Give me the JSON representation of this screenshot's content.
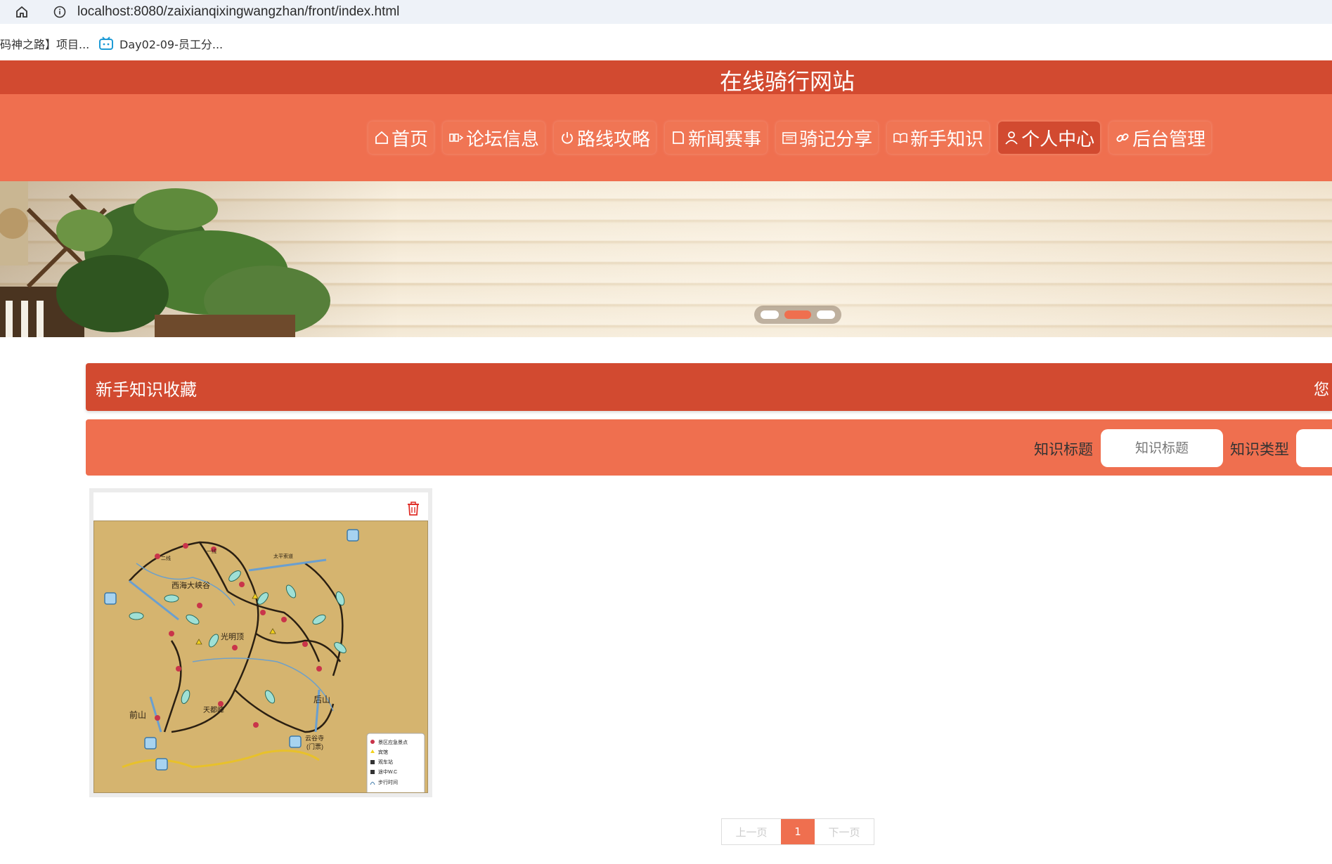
{
  "browser": {
    "url": "localhost:8080/zaixianqixingwangzhan/front/index.html",
    "bookmarks": [
      "码神之路】项目...",
      "Day02-09-员工分..."
    ]
  },
  "site": {
    "title": "在线骑行网站",
    "nav": [
      {
        "label": "首页",
        "icon": "home-icon"
      },
      {
        "label": "论坛信息",
        "icon": "forum-icon"
      },
      {
        "label": "路线攻略",
        "icon": "power-icon"
      },
      {
        "label": "新闻赛事",
        "icon": "news-icon"
      },
      {
        "label": "骑记分享",
        "icon": "calendar-icon"
      },
      {
        "label": "新手知识",
        "icon": "book-icon"
      },
      {
        "label": "个人中心",
        "icon": "user-icon",
        "active": true
      },
      {
        "label": "后台管理",
        "icon": "link-icon"
      }
    ]
  },
  "banner": {
    "slides": 3,
    "active_slide": 2
  },
  "section": {
    "title": "新手知识收藏",
    "right_text": "您"
  },
  "search": {
    "title_label": "知识标题",
    "title_placeholder": "知识标题",
    "type_label": "知识类型",
    "type_placeholder": ""
  },
  "card": {
    "map_labels": [
      "西海大峡谷",
      "光明顶",
      "前山",
      "后山",
      "天都峰",
      "云谷寺",
      "(门票)",
      "太平索道",
      "二线",
      "一线"
    ],
    "legend": [
      "景区应急景点",
      "宾馆",
      "观车站",
      "途中W.C",
      "步行时间"
    ]
  },
  "pagination": {
    "prev": "上一页",
    "current": "1",
    "next": "下一页"
  },
  "colors": {
    "primary_dark": "#d24a30",
    "primary": "#ef6f4f"
  }
}
